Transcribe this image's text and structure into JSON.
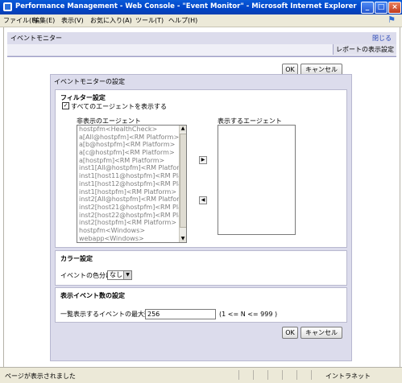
{
  "window": {
    "title": "Performance Management - Web Console - \"Event Monitor\" - Microsoft Internet Explorer"
  },
  "menu": [
    "ファイル(F)",
    "編集(E)",
    "表示(V)",
    "お気に入り(A)",
    "ツール(T)",
    "ヘルプ(H)"
  ],
  "header": {
    "title": "イベントモニター",
    "close_link": "閉じる",
    "tab": "レポートの表示設定"
  },
  "buttons": {
    "ok": "OK",
    "cancel": "キャンセル"
  },
  "panel": {
    "title": "イベントモニターの設定"
  },
  "filter": {
    "title": "フィルター設定",
    "checkbox_label": "すべてのエージェントを表示する",
    "checked": true,
    "hidden_label": "非表示のエージェント",
    "shown_label": "表示するエージェント",
    "hidden_agents": [
      "hostpfm<HealthCheck>",
      "a[All@hostpfm]<RM Platform>",
      "a[b@hostpfm]<RM Platform>",
      "a[c@hostpfm]<RM Platform>",
      "a[hostpfm]<RM Platform>",
      "inst1[All@hostpfm]<RM Platform",
      "inst1[host11@hostpfm]<RM Pla",
      "inst1[host12@hostpfm]<RM Pla",
      "inst1[hostpfm]<RM Platform>",
      "inst2[All@hostpfm]<RM Platform",
      "inst2[host21@hostpfm]<RM Pla",
      "inst2[host22@hostpfm]<RM Pla",
      "inst2[hostpfm]<RM Platform>",
      "hostpfm<Windows>",
      "webapp<Windows>"
    ],
    "shown_agents": []
  },
  "color": {
    "title": "カラー設定",
    "label": "イベントの色分け",
    "value": "なし"
  },
  "count": {
    "title": "表示イベント数の設定",
    "label": "一覧表示するイベントの最大数",
    "value": "256",
    "range": "(1 <= N <= 999 )"
  },
  "status": {
    "text": "ページが表示されました",
    "zone": "イントラネット"
  }
}
